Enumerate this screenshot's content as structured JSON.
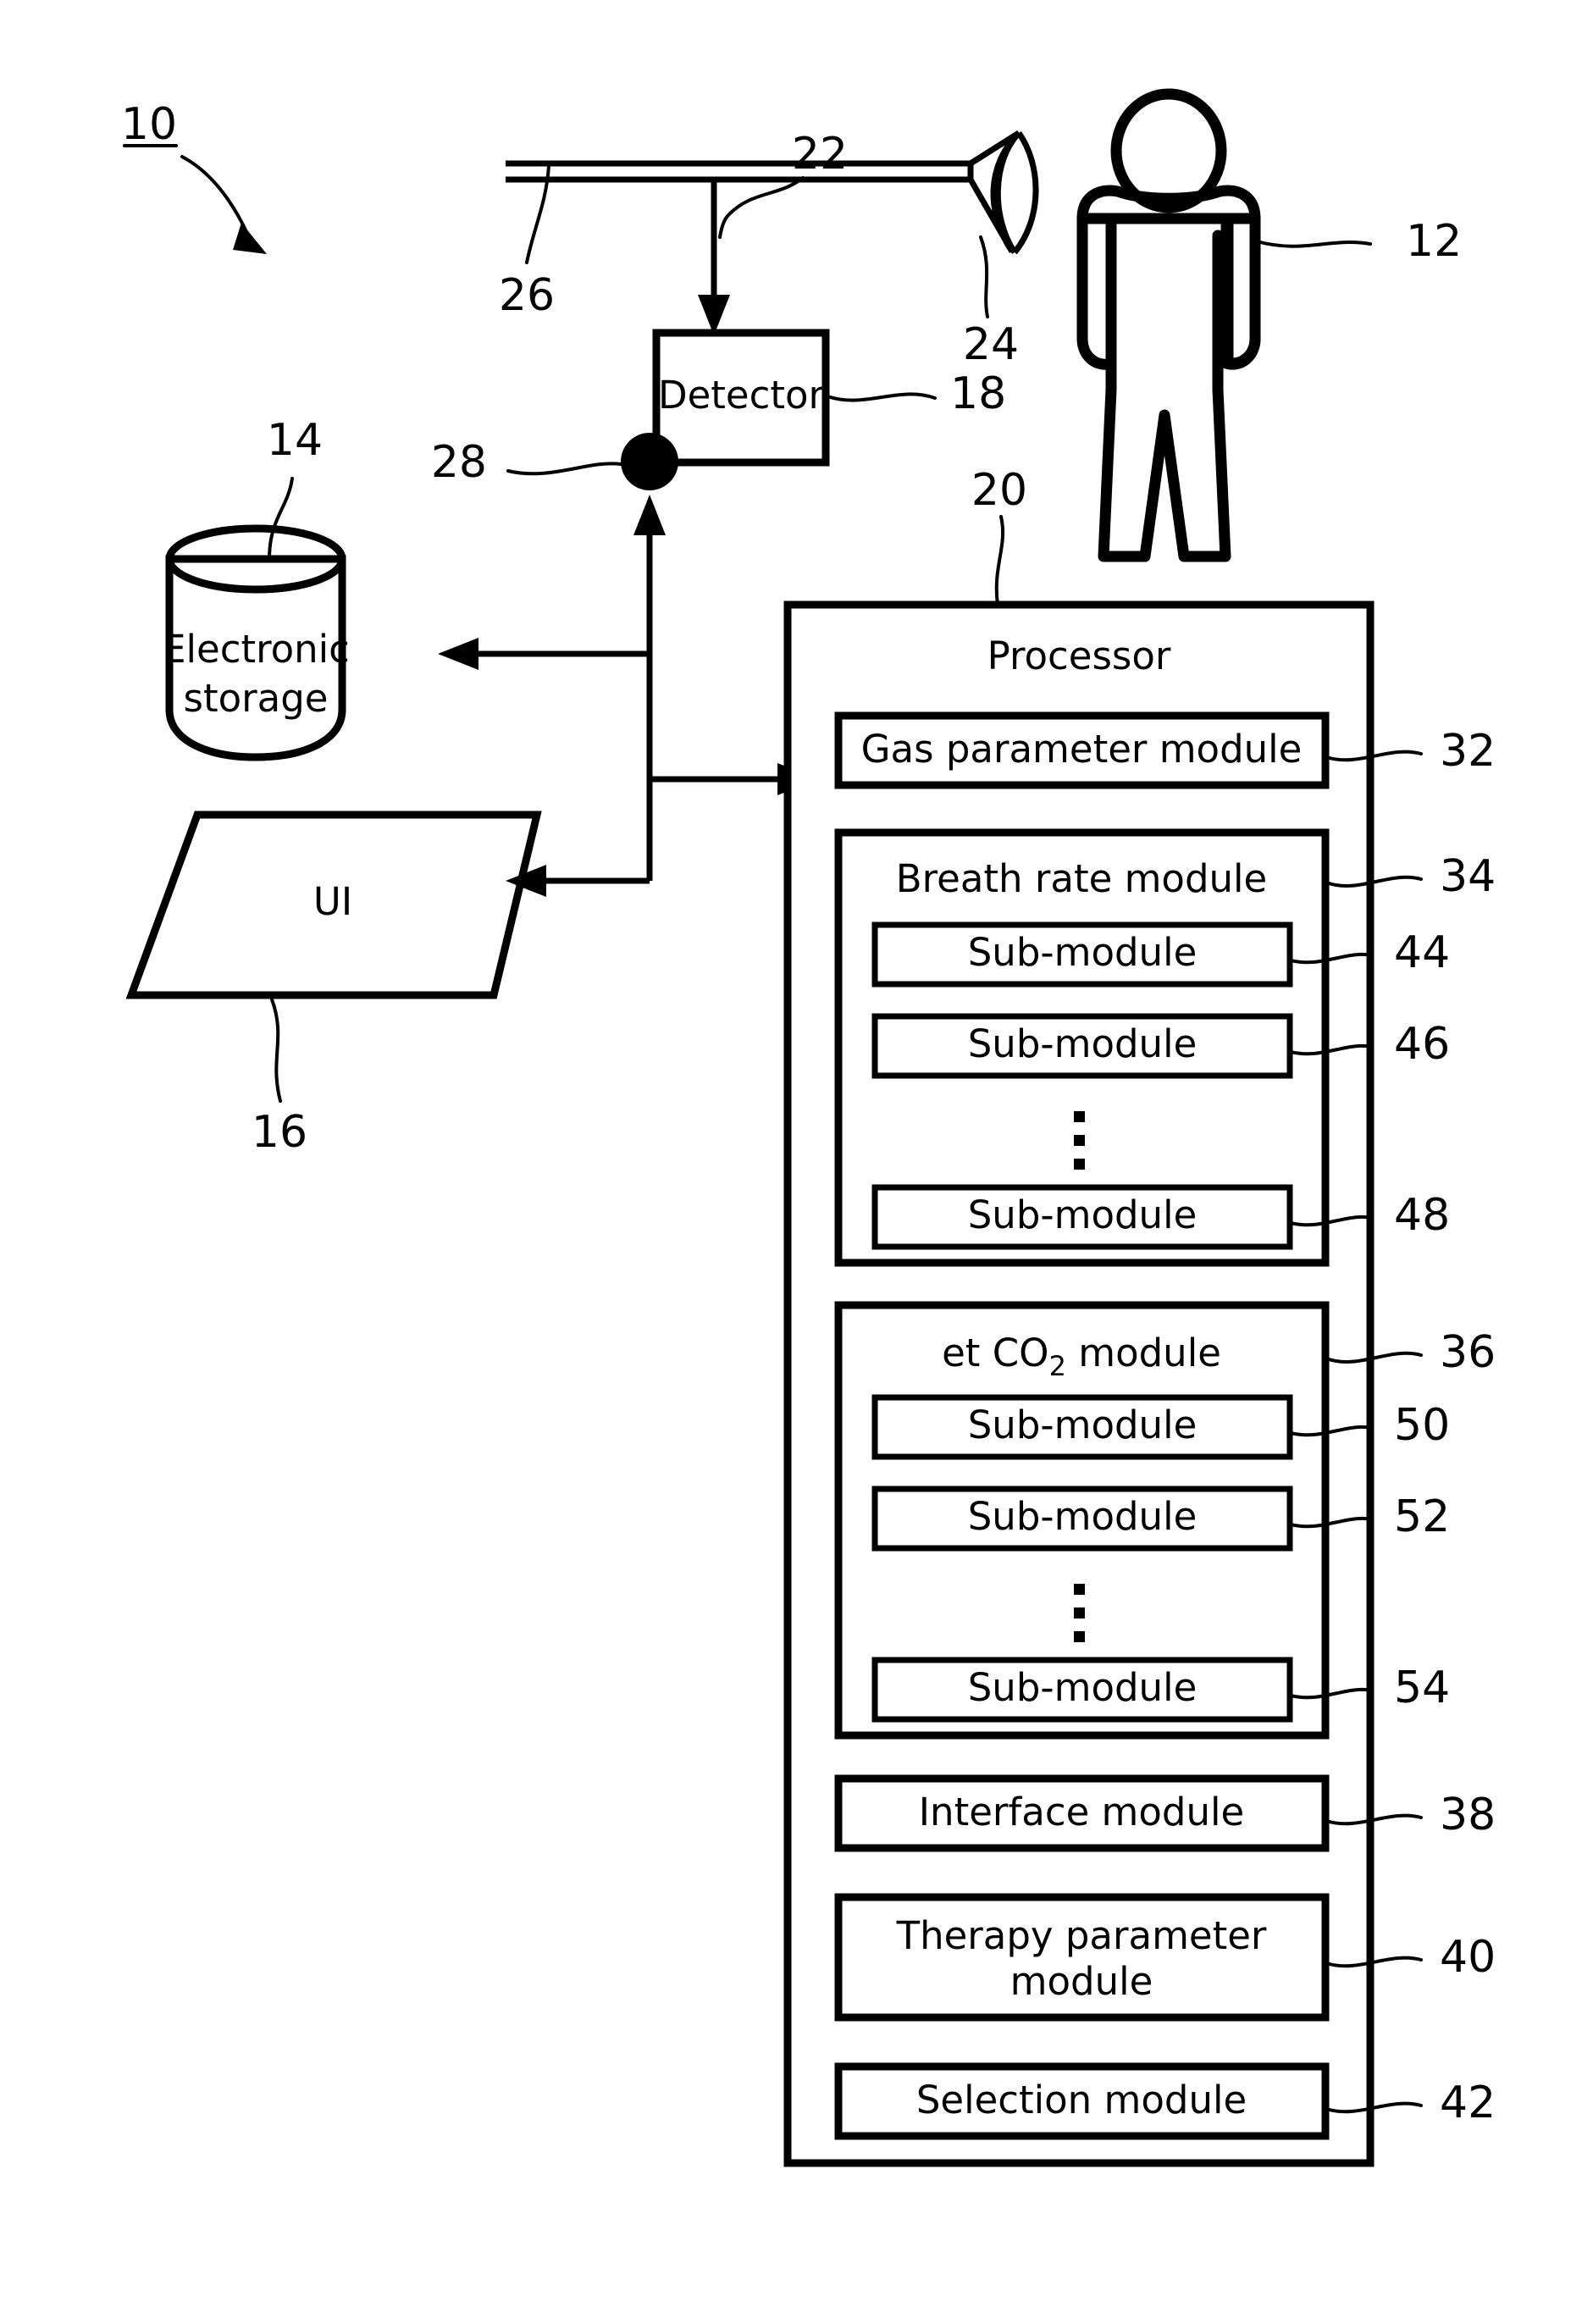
{
  "figure": {
    "system_ref": "10",
    "labels": {
      "subject": "12",
      "electronic_storage": "14",
      "ui": "16",
      "detector": "18",
      "processor": "20",
      "conduit_arrow": "22",
      "mask": "24",
      "circuit": "26",
      "node": "28"
    }
  },
  "nodes": {
    "electronic_storage": {
      "line1": "Electronic",
      "line2": "storage",
      "ref": "14"
    },
    "ui": {
      "label": "UI",
      "ref": "16"
    },
    "detector": {
      "label": "Detector",
      "ref": "18"
    },
    "processor": {
      "label": "Processor",
      "ref": "20"
    },
    "subject": {
      "ref": "12"
    },
    "mask": {
      "ref": "24"
    },
    "circuit": {
      "ref": "26"
    },
    "junction": {
      "ref": "28"
    },
    "conduit": {
      "ref": "22"
    }
  },
  "processor_modules": [
    {
      "id": "gas-parameter-module",
      "label": "Gas parameter module",
      "ref": "32",
      "submodules": []
    },
    {
      "id": "breath-rate-module",
      "label": "Breath rate module",
      "ref": "34",
      "submodules": [
        {
          "label": "Sub-module",
          "ref": "44"
        },
        {
          "label": "Sub-module",
          "ref": "46"
        },
        {
          "label": "Sub-module",
          "ref": "48"
        }
      ]
    },
    {
      "id": "et-co2-module",
      "label_prefix": "et CO",
      "label_subscript": "2",
      "label_suffix": " module",
      "label": "et CO2 module",
      "ref": "36",
      "submodules": [
        {
          "label": "Sub-module",
          "ref": "50"
        },
        {
          "label": "Sub-module",
          "ref": "52"
        },
        {
          "label": "Sub-module",
          "ref": "54"
        }
      ]
    },
    {
      "id": "interface-module",
      "label": "Interface module",
      "ref": "38",
      "submodules": []
    },
    {
      "id": "therapy-parameter-module",
      "label_line1": "Therapy parameter",
      "label_line2": "module",
      "label": "Therapy parameter module",
      "ref": "40",
      "submodules": []
    },
    {
      "id": "selection-module",
      "label": "Selection module",
      "ref": "42",
      "submodules": []
    }
  ],
  "colors": {
    "ink": "#000000",
    "paper": "#ffffff"
  }
}
